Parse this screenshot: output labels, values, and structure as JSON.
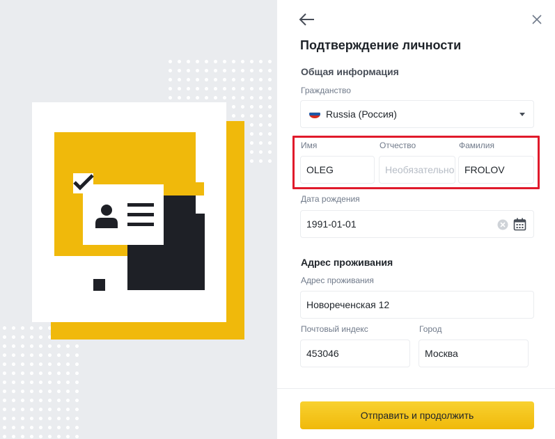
{
  "form": {
    "title": "Подтверждение личности",
    "general_section": "Общая информация",
    "citizenship": {
      "label": "Гражданство",
      "value": "Russia (Россия)"
    },
    "first_name": {
      "label": "Имя",
      "value": "OLEG"
    },
    "patronymic": {
      "label": "Отчество",
      "placeholder": "Необязательно"
    },
    "last_name": {
      "label": "Фамилия",
      "value": "FROLOV"
    },
    "birth_date": {
      "label": "Дата рождения",
      "value": "1991-01-01"
    },
    "address_section": "Адрес проживания",
    "address": {
      "label": "Адрес проживания",
      "value": "Новореченская 12"
    },
    "postal_code": {
      "label": "Почтовый индекс",
      "value": "453046"
    },
    "city": {
      "label": "Город",
      "value": "Москва"
    },
    "submit_label": "Отправить и продолжить"
  },
  "icons": {
    "back": "arrow-left-icon",
    "close": "close-icon",
    "flag": "russia-flag-icon",
    "dropdown": "chevron-down-icon",
    "clear": "clear-icon",
    "calendar": "calendar-icon"
  },
  "colors": {
    "accent": "#f0b90b",
    "highlight": "#e01a2b",
    "dark": "#1e2026",
    "panel_bg": "#eaecef"
  }
}
